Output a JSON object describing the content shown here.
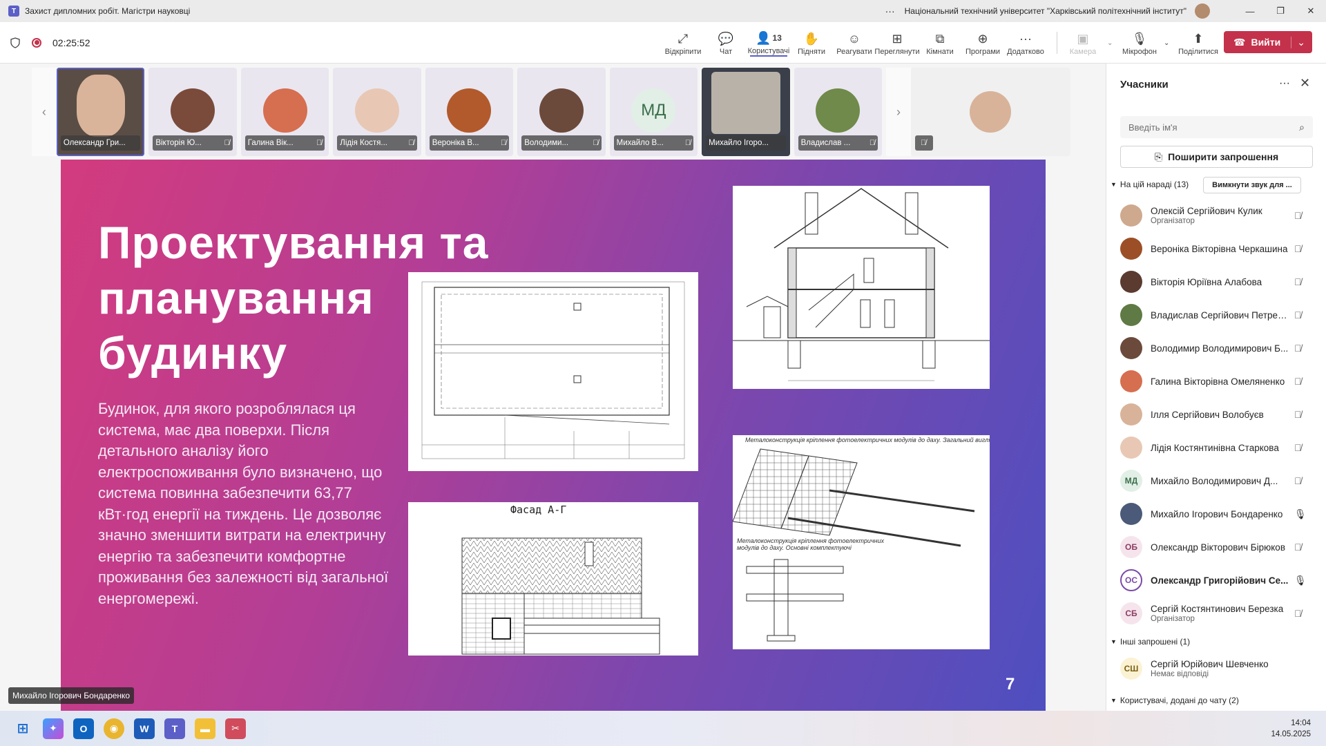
{
  "window": {
    "title": "Захист дипломних робіт. Магістри науковці",
    "organization": "Національний технічний університет \"Харківський політехнічний інститут\"",
    "more": "···"
  },
  "meeting": {
    "timer": "02:25:52",
    "participants_count": "13",
    "tools": [
      {
        "label": "Відкріпити",
        "icon": "unpin-icon"
      },
      {
        "label": "Чат",
        "icon": "chat-icon"
      },
      {
        "label": "Користувачі",
        "icon": "people-icon"
      },
      {
        "label": "Підняти",
        "icon": "raise-hand-icon"
      },
      {
        "label": "Реагувати",
        "icon": "react-icon"
      },
      {
        "label": "Переглянути",
        "icon": "view-icon"
      },
      {
        "label": "Кімнати",
        "icon": "rooms-icon"
      },
      {
        "label": "Програми",
        "icon": "apps-icon"
      },
      {
        "label": "Додатково",
        "icon": "more-icon"
      }
    ],
    "camera_label": "Камера",
    "mic_label": "Мікрофон",
    "share_label": "Поділитися",
    "leave_label": "Вийти"
  },
  "thumbnails": [
    {
      "name": "Олександр Гри...",
      "selected": true
    },
    {
      "name": "Вікторія Ю..."
    },
    {
      "name": "Галина Вік..."
    },
    {
      "name": "Лідія Костя..."
    },
    {
      "name": "Вероніка В..."
    },
    {
      "name": "Володими..."
    },
    {
      "name": "Михайло В...",
      "initials": "МД"
    },
    {
      "name": "Михайло Ігоро..."
    },
    {
      "name": "Владислав ..."
    }
  ],
  "slide": {
    "title": "Проектування та планування будинку",
    "body": "Будинок, для якого розроблялася ця система, має два поверхи. Після детального аналізу його електроспоживання було визначено, що система повинна забезпечити 63,77 кВт·год енергії на тиждень. Це дозволяє значно зменшити витрати на електричну енергію та забезпечити комфортне проживання без залежності від загальної енергомережі.",
    "page_number": "7",
    "facade_label": "Фасад А-Г",
    "mount_title_1": "Металоконструкція кріплення фотоелектричних модулів до даху. Загальний вигляд",
    "mount_title_2": "Металоконструкція кріплення фотоелектричних модулів до даху. Основні комплектуючі"
  },
  "speaker_label": "Михайло Ігорович Бондаренко",
  "panel": {
    "title": "Учасники",
    "search_placeholder": "Введіть ім'я",
    "invite_label": "Поширити запрошення",
    "in_meeting_label": "На цій нараді (13)",
    "mute_all_label": "Вимкнути звук для ...",
    "others_label": "Інші запрошені (1)",
    "chat_added_label": "Користувачі, додані до чату (2)",
    "participants": [
      {
        "name": "Олексій Сергійович Кулик",
        "role": "Організатор",
        "mic": "muted"
      },
      {
        "name": "Вероніка Вікторівна Черкашина",
        "role": "",
        "mic": "muted"
      },
      {
        "name": "Вікторія Юріївна Алабова",
        "role": "",
        "mic": "muted"
      },
      {
        "name": "Владислав Сергійович Петренко",
        "role": "",
        "mic": "muted"
      },
      {
        "name": "Володимир Володимирович Б...",
        "role": "",
        "mic": "muted"
      },
      {
        "name": "Галина Вікторівна Омеляненко",
        "role": "",
        "mic": "muted"
      },
      {
        "name": "Ілля Сергійович Волобуєв",
        "role": "",
        "mic": "muted"
      },
      {
        "name": "Лідія Костянтинівна Старкова",
        "role": "",
        "mic": "muted"
      },
      {
        "name": "Михайло Володимирович Д...",
        "role": "",
        "initials": "МД",
        "mic": "muted"
      },
      {
        "name": "Михайло Ігорович Бондаренко",
        "role": "",
        "mic": "on"
      },
      {
        "name": "Олександр Вікторович Бірюков",
        "role": "",
        "initials": "ОБ",
        "mic": "muted"
      },
      {
        "name": "Олександр Григорійович Се...",
        "role": "",
        "initials": "ОС",
        "mic": "on",
        "bold": true
      },
      {
        "name": "Сергій Костянтинович Березка",
        "role": "Організатор",
        "initials": "СБ",
        "mic": "muted"
      }
    ],
    "invited": {
      "name": "Сергій Юрійович Шевченко",
      "role": "Немає відповіді",
      "initials": "СШ"
    }
  },
  "taskbar": {
    "time": "14:04",
    "date": "14.05.2025"
  },
  "colors": {
    "accent": "#5b5fc7",
    "leave": "#c4314b"
  }
}
